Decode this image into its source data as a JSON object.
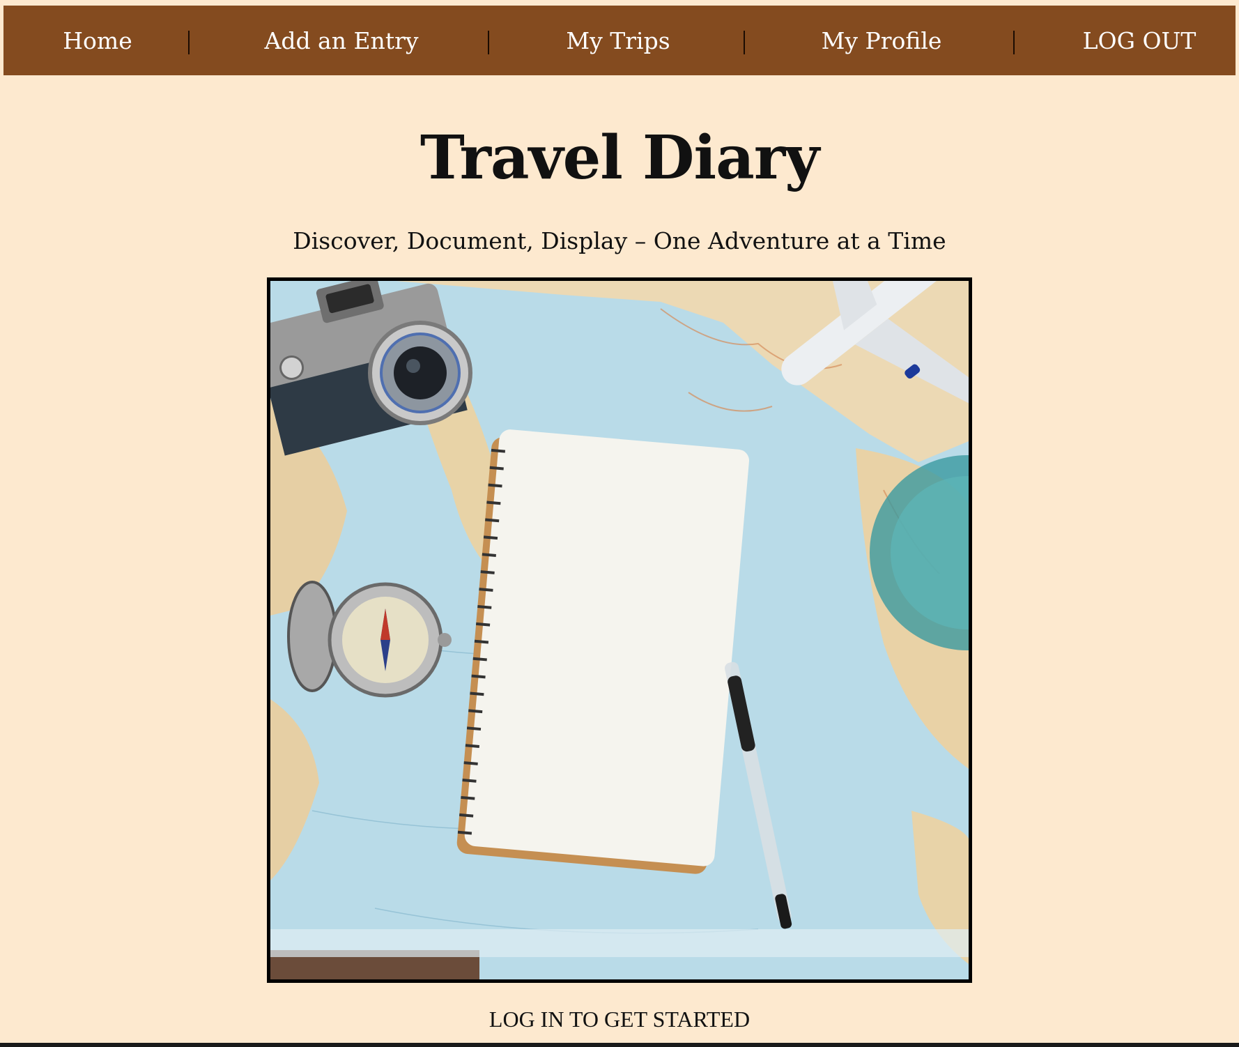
{
  "nav": {
    "home": "Home",
    "add_entry": "Add an Entry",
    "my_trips": "My Trips",
    "my_profile": "My Profile",
    "logout": "LOG OUT"
  },
  "hero": {
    "title": "Travel Diary",
    "subtitle": "Discover, Document, Display – One Adventure at a Time"
  },
  "cta": {
    "label": "LOG IN TO GET STARTED"
  },
  "colors": {
    "nav_background": "#844b1f",
    "page_background": "#fde9cf",
    "nav_text": "#ffffff"
  }
}
